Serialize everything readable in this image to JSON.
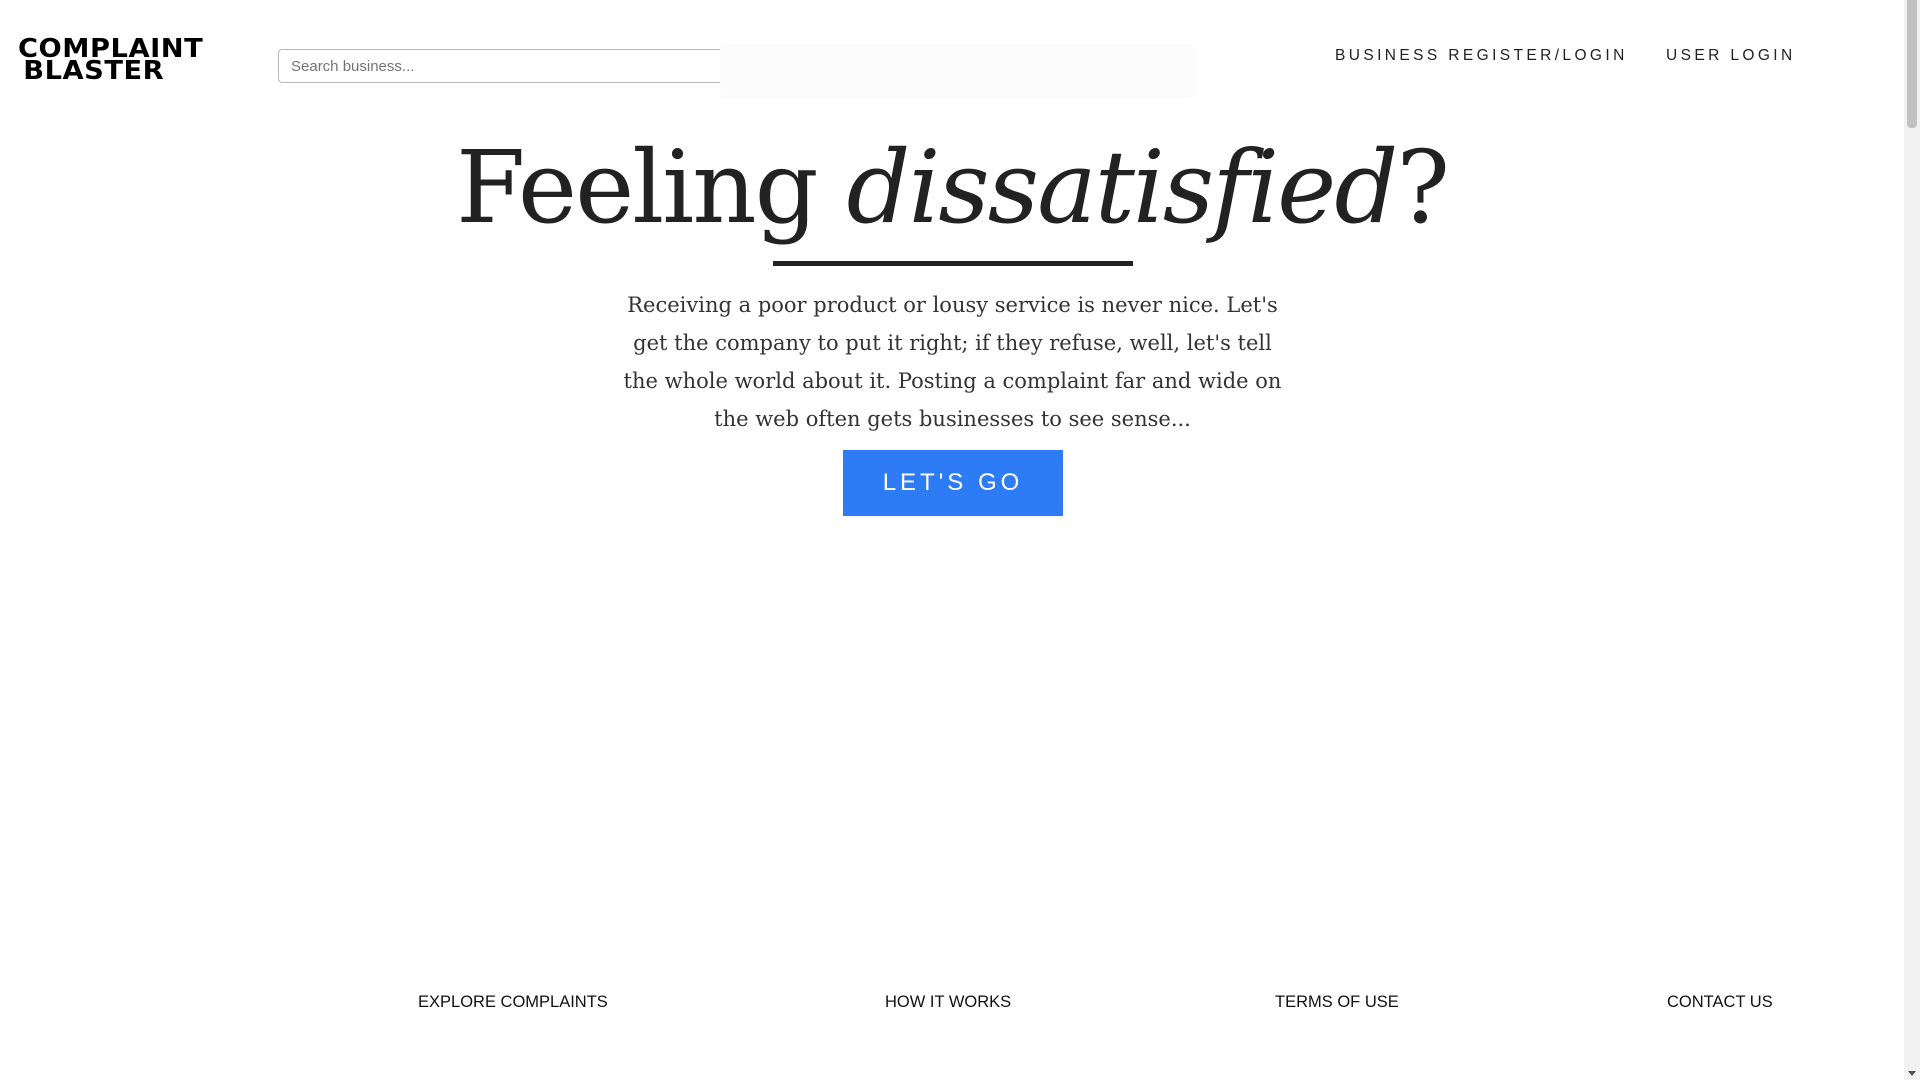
{
  "header": {
    "logo": {
      "line1": "COMPLAINT",
      "line2": "BLASTER"
    },
    "search": {
      "placeholder": "Search business..."
    },
    "nav": {
      "business": "BUSINESS REGISTER/LOGIN",
      "user": "USER LOGIN"
    }
  },
  "hero": {
    "title_plain": "Feeling ",
    "title_emphasis": "dissatisfied",
    "title_end": "?",
    "body": "Receiving a poor product or lousy service is never nice. Let's get the company to put it right; if they refuse, well, let's tell the whole world about it. Posting a complaint far and wide on the web often gets businesses to see sense...",
    "cta_label": "LET'S GO"
  },
  "footer": {
    "links": [
      "EXPLORE COMPLAINTS",
      "HOW IT WORKS",
      "TERMS OF USE",
      "CONTACT US"
    ]
  },
  "colors": {
    "accent": "#2d7cf6",
    "text": "#222222"
  },
  "icons": {
    "scroll_down": "chevron-down-icon"
  }
}
